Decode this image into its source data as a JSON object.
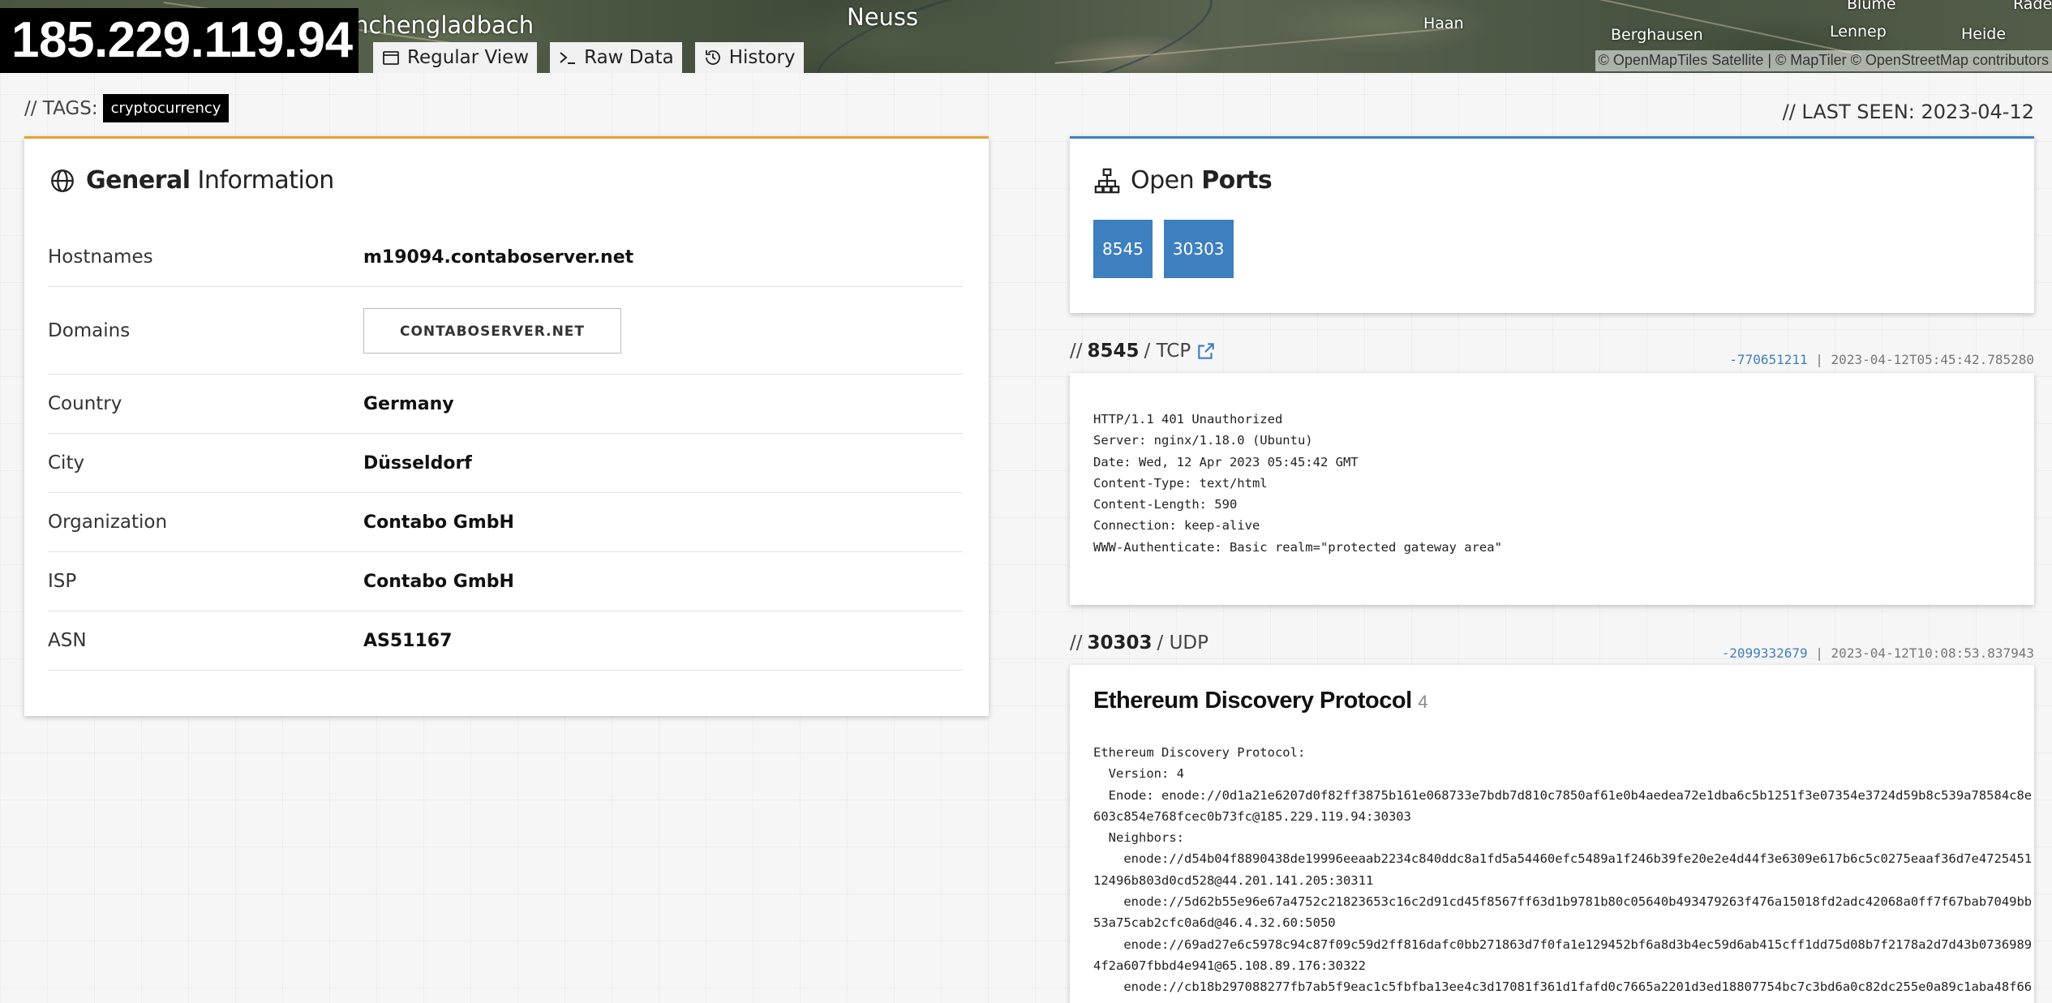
{
  "map": {
    "labels": [
      {
        "text": "nchengladbach"
      },
      {
        "text": "Neuss"
      },
      {
        "text": "Haan"
      },
      {
        "text": "Berghausen"
      },
      {
        "text": "Lennep"
      },
      {
        "text": "Heide"
      },
      {
        "text": "Blume"
      },
      {
        "text": "Rade"
      }
    ],
    "attribution": "© OpenMapTiles Satellite | © MapTiler © OpenStreetMap contributors"
  },
  "header": {
    "ip": "185.229.119.94",
    "buttons": [
      {
        "label": "Regular View",
        "icon": "calendar-icon"
      },
      {
        "label": "Raw Data",
        "icon": "terminal-icon"
      },
      {
        "label": "History",
        "icon": "history-icon"
      }
    ]
  },
  "tags": {
    "label": "// TAGS:",
    "items": [
      "cryptocurrency"
    ]
  },
  "last_seen": "// LAST SEEN: 2023-04-12",
  "general": {
    "title_bold": "General",
    "title_rest": "Information",
    "rows": [
      {
        "key": "Hostnames",
        "value": "m19094.contaboserver.net"
      },
      {
        "key": "Domains",
        "value": "CONTABOSERVER.NET"
      },
      {
        "key": "Country",
        "value": "Germany"
      },
      {
        "key": "City",
        "value": "Düsseldorf"
      },
      {
        "key": "Organization",
        "value": "Contabo GmbH"
      },
      {
        "key": "ISP",
        "value": "Contabo GmbH"
      },
      {
        "key": "ASN",
        "value": "AS51167"
      }
    ]
  },
  "ports": {
    "title_rest": "Open",
    "title_bold": "Ports",
    "items": [
      "8545",
      "30303"
    ]
  },
  "services": [
    {
      "prefix": "//",
      "port": "8545",
      "proto": "/ TCP",
      "hash": "-770651211",
      "sep": "|",
      "timestamp": "2023-04-12T05:45:42.785280",
      "banner": "HTTP/1.1 401 Unauthorized\nServer: nginx/1.18.0 (Ubuntu)\nDate: Wed, 12 Apr 2023 05:45:42 GMT\nContent-Type: text/html\nContent-Length: 590\nConnection: keep-alive\nWWW-Authenticate: Basic realm=\"protected gateway area\""
    },
    {
      "prefix": "//",
      "port": "30303",
      "proto": "/ UDP",
      "hash": "-2099332679",
      "sep": "|",
      "timestamp": "2023-04-12T10:08:53.837943",
      "title": "Ethereum Discovery Protocol",
      "version": "4",
      "banner": "Ethereum Discovery Protocol:\n  Version: 4\n  Enode: enode://0d1a21e6207d0f82ff3875b161e068733e7bdb7d810c7850af61e0b4aedea72e1dba6c5b1251f3e07354e3724d59b8c539a78584c8e\n603c854e768fcec0b73fc@185.229.119.94:30303\n  Neighbors:\n    enode://d54b04f8890438de19996eeaab2234c840ddc8a1fd5a54460efc5489a1f246b39fe20e2e4d44f3e6309e617b6c5c0275eaaf36d7e4725451\n12496b803d0cd528@44.201.141.205:30311\n    enode://5d62b55e96e67a4752c21823653c16c2d91cd45f8567ff63d1b9781b80c05640b493479263f476a15018fd2adc42068a0ff7f67bab7049bb\n53a75cab2cfc0a6d@46.4.32.60:5050\n    enode://69ad27e6c5978c94c87f09c59d2ff816dafc0bb271863d7f0fa1e129452bf6a8d3b4ec59d6ab415cff1dd75d08b7f2178a2d7d43b0736989\n4f2a607fbbd4e941@65.108.89.176:30322\n    enode://cb18b297088277fb7ab5f9eac1c5fbfba13ee4c3d17081f361d1fafd0c7665a2201d3ed18807754bc7c3bd6a0c82dc255e0a89c1aba48f66"
    }
  ]
}
